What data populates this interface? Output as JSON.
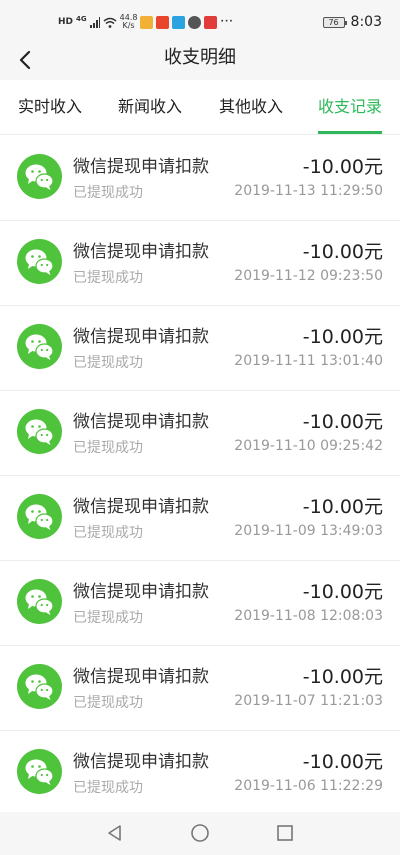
{
  "status_bar": {
    "hd": "HD",
    "network": "4G",
    "speed_value": "44.8",
    "speed_unit": "K/s",
    "app1_label": "",
    "battery": "76",
    "time": "8:03"
  },
  "header": {
    "title": "收支明细"
  },
  "tabs": [
    {
      "label": "实时收入"
    },
    {
      "label": "新闻收入"
    },
    {
      "label": "其他收入"
    },
    {
      "label": "收支记录"
    }
  ],
  "active_tab": 3,
  "records": [
    {
      "title": "微信提现申请扣款",
      "status": "已提现成功",
      "amount": "-10.00元",
      "time": "2019-11-13 11:29:50"
    },
    {
      "title": "微信提现申请扣款",
      "status": "已提现成功",
      "amount": "-10.00元",
      "time": "2019-11-12 09:23:50"
    },
    {
      "title": "微信提现申请扣款",
      "status": "已提现成功",
      "amount": "-10.00元",
      "time": "2019-11-11 13:01:40"
    },
    {
      "title": "微信提现申请扣款",
      "status": "已提现成功",
      "amount": "-10.00元",
      "time": "2019-11-10 09:25:42"
    },
    {
      "title": "微信提现申请扣款",
      "status": "已提现成功",
      "amount": "-10.00元",
      "time": "2019-11-09 13:49:03"
    },
    {
      "title": "微信提现申请扣款",
      "status": "已提现成功",
      "amount": "-10.00元",
      "time": "2019-11-08 12:08:03"
    },
    {
      "title": "微信提现申请扣款",
      "status": "已提现成功",
      "amount": "-10.00元",
      "time": "2019-11-07 11:21:03"
    },
    {
      "title": "微信提现申请扣款",
      "status": "已提现成功",
      "amount": "-10.00元",
      "time": "2019-11-06 11:22:29"
    }
  ],
  "colors": {
    "accent": "#2fb75a",
    "wechat_green": "#4fc33b"
  },
  "icons": {
    "avatar": "wechat-icon",
    "back": "back-arrow-icon",
    "nav": [
      "back-triangle-icon",
      "home-circle-icon",
      "recents-square-icon"
    ]
  }
}
